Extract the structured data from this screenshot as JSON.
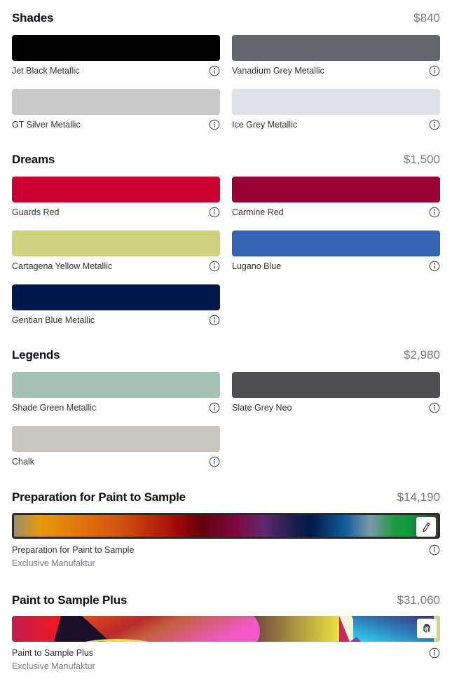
{
  "sections": [
    {
      "title": "Shades",
      "price": "$840",
      "options": [
        {
          "name": "Jet Black Metallic",
          "color": "#000000"
        },
        {
          "name": "Vanadium Grey Metallic",
          "color": "#63676b"
        },
        {
          "name": "GT Silver Metallic",
          "color": "#c9c9c9"
        },
        {
          "name": "Ice Grey Metallic",
          "color": "#dfe1e6"
        }
      ]
    },
    {
      "title": "Dreams",
      "price": "$1,500",
      "options": [
        {
          "name": "Guards Red",
          "color": "#cc0030"
        },
        {
          "name": "Carmine Red",
          "color": "#990033"
        },
        {
          "name": "Cartagena Yellow Metallic",
          "color": "#cfd27e"
        },
        {
          "name": "Lugano Blue",
          "color": "#3564b3"
        },
        {
          "name": "Gentian Blue Metallic",
          "color": "#00184a"
        }
      ]
    },
    {
      "title": "Legends",
      "price": "$2,980",
      "options": [
        {
          "name": "Shade Green Metallic",
          "color": "#a4c3b6"
        },
        {
          "name": "Slate Grey Neo",
          "color": "#4e4e53"
        },
        {
          "name": "Chalk",
          "color": "#c8c6bf"
        }
      ]
    }
  ],
  "pts": {
    "title": "Preparation for Paint to Sample",
    "price": "$14,190",
    "option_name": "Preparation for Paint to Sample",
    "sublabel": "Exclusive Manufaktur",
    "action_icon": "pencil-icon"
  },
  "ptsplus": {
    "title": "Paint to Sample Plus",
    "price": "$31,060",
    "option_name": "Paint to Sample Plus",
    "sublabel": "Exclusive Manufaktur",
    "action_icon": "fingerprint-icon"
  }
}
